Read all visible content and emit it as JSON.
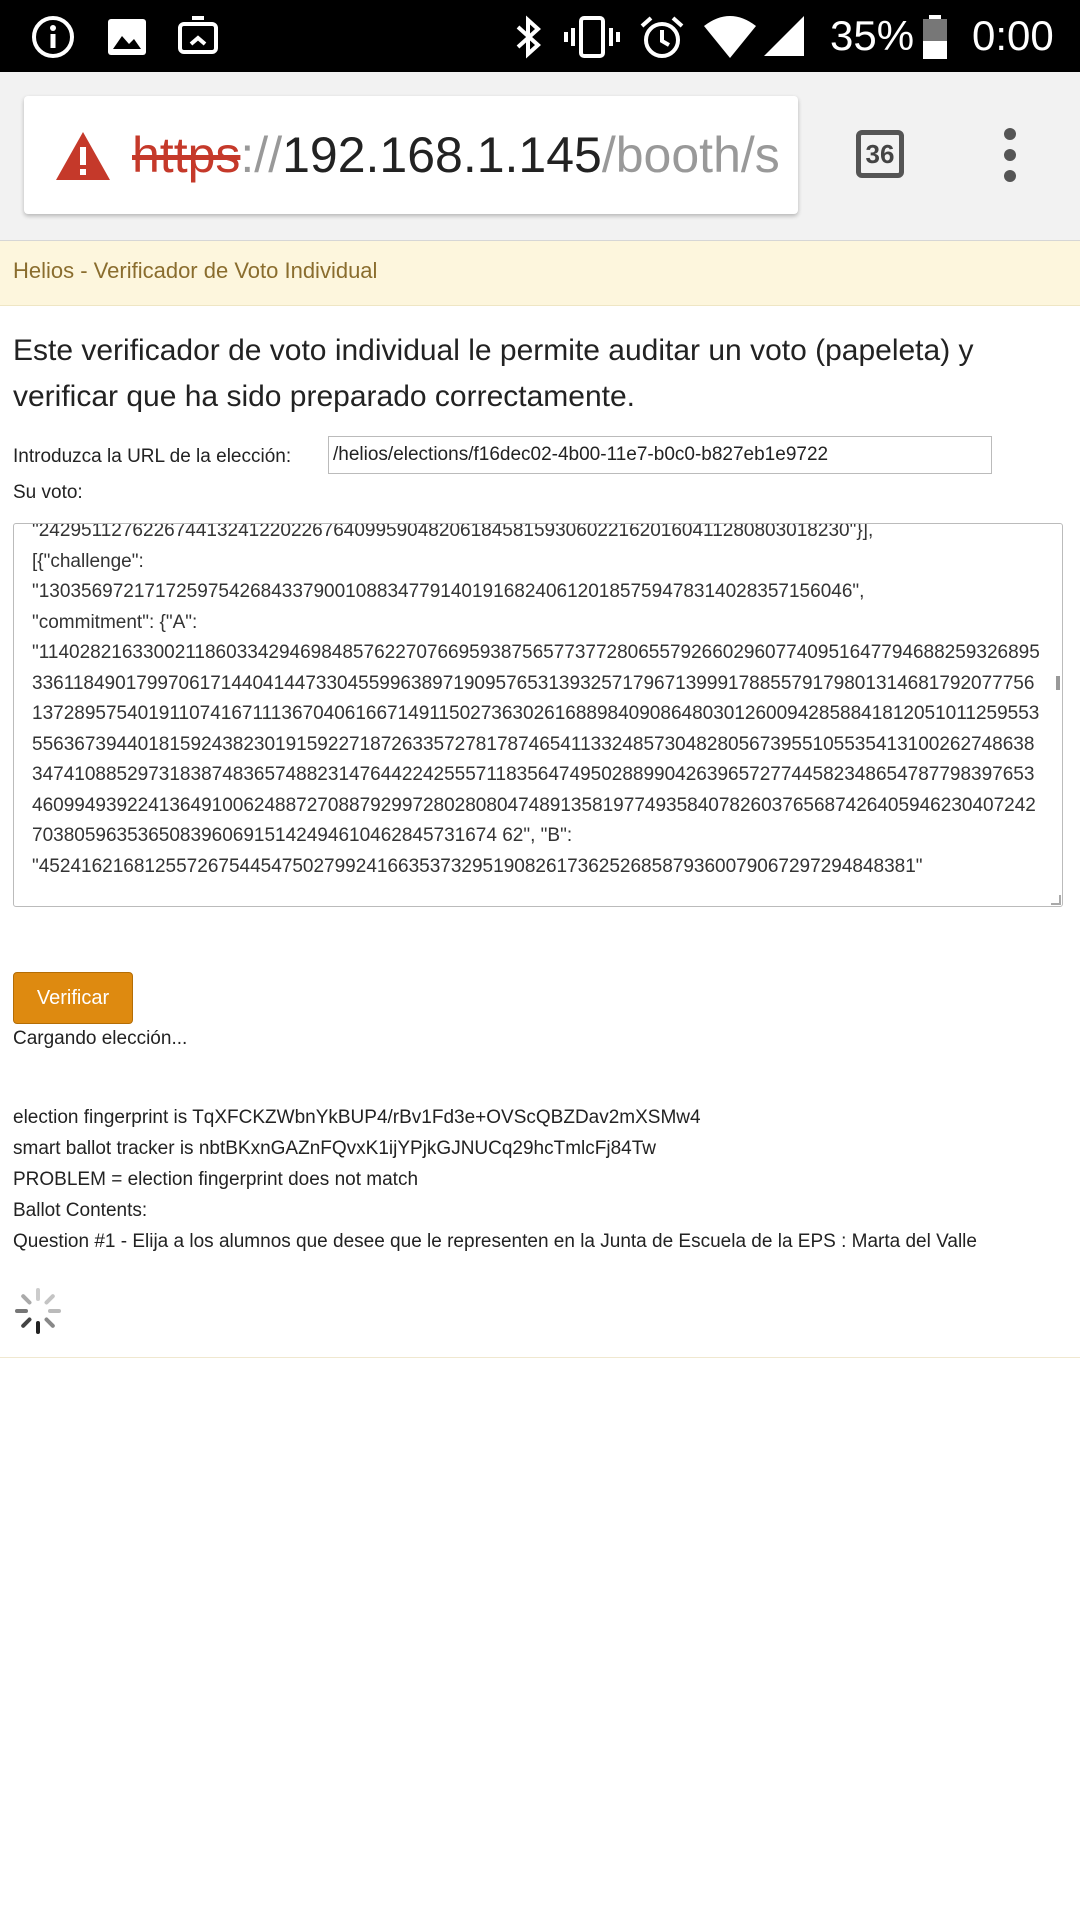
{
  "status_bar": {
    "left_icons": [
      "info-icon",
      "image-icon",
      "screencast-icon"
    ],
    "right_icons": [
      "bluetooth-icon",
      "vibrate-icon",
      "alarm-icon",
      "wifi-icon",
      "signal-icon",
      "battery-icon"
    ],
    "battery": "35%",
    "time": "0:00"
  },
  "browser": {
    "url_scheme": "https",
    "url_sep": "://",
    "url_host": "192.168.1.145",
    "url_path": "/booth/s",
    "tab_count": "36",
    "warning_icon": "warning-icon",
    "menu_icon": "overflow-menu-icon"
  },
  "page": {
    "header_title": "Helios - Verificador de Voto Individual",
    "intro": "Este verificador de voto individual le permite auditar un voto (papeleta) y verificar que ha sido preparado correctamente.",
    "url_label": "Introduzca la URL de la elección:",
    "url_value": "/helios/elections/f16dec02-4b00-11e7-b0c0-b827eb1e9722",
    "vote_label": "Su voto:",
    "vote_text": "\"24295112762267441324122022676409959048206184581593060221620160411280803018230\"}],\n[{\"challenge\":\n\"13035697217172597542684337900108834779140191682406120185759478314028357156046\",\n\"commitment\": {\"A\":\n\"114028216330021186033429469848576227076695938756577377280655792660296077409516477946882593268953361184901799706171440414473304559963897190957653139325717967139991788557917980131468179207775613728957540191107416711136704061667149115027363026168898409086480301260094285884181205101125955355636739440181592438230191592271872633572781787465411332485730482805673955105535413100262748638347410885297318387483657488231476442242555711835647495028899042639657277445823486547877983976534609949392241364910062488727088792997280280804748913581977493584078260376568742640594623040724270380596353650839606915142494610462845731674 62\", \"B\":\n\"45241621681255726754454750279924166353732951908261736252685879360079067297294848381\"",
    "verify_button": "Verificar",
    "loading": "Cargando elección...",
    "results": {
      "fingerprint": "election fingerprint is TqXFCKZWbnYkBUP4/rBv1Fd3e+OVScQBZDav2mXSMw4",
      "tracker": "smart ballot tracker is nbtBKxnGAZnFQvxK1ijYPjkGJNUCq29hcTmlcFj84Tw",
      "problem": "PROBLEM = election fingerprint does not match",
      "contents_label": "Ballot Contents:",
      "question": "Question #1 - Elija a los alumnos que desee que le representen en la Junta de Escuela de la EPS : Marta del Valle"
    }
  }
}
